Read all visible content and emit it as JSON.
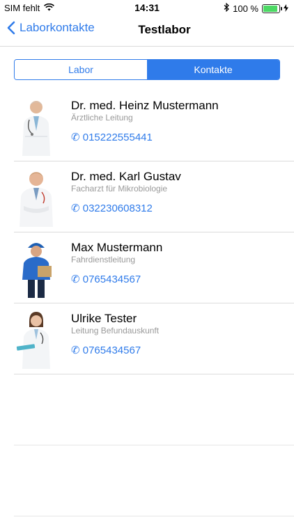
{
  "status": {
    "carrier": "SIM fehlt",
    "time": "14:31",
    "battery": "100 %"
  },
  "nav": {
    "back_label": "Laborkontakte",
    "title": "Testlabor"
  },
  "segments": {
    "labor": "Labor",
    "kontakte": "Kontakte"
  },
  "contacts": [
    {
      "name": "Dr. med. Heinz Mustermann",
      "role": "Ärztliche Leitung",
      "phone": "✆ 015222555441"
    },
    {
      "name": "Dr. med. Karl Gustav",
      "role": "Facharzt für Mikrobiologie",
      "phone": "✆ 032230608312"
    },
    {
      "name": "Max Mustermann",
      "role": "Fahrdienstleitung",
      "phone": "✆ 0765434567"
    },
    {
      "name": "Ulrike Tester",
      "role": "Leitung Befundauskunft",
      "phone": "✆ 0765434567"
    }
  ]
}
